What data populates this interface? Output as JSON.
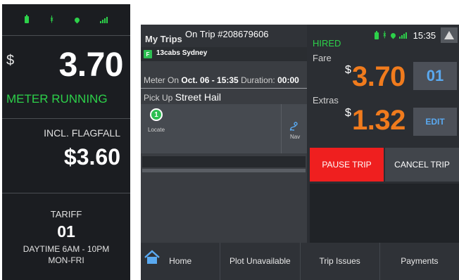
{
  "phone": {
    "status_icons": [
      "battery-icon",
      "bluetooth-icon",
      "location-icon",
      "signal-icon"
    ],
    "currency": "$",
    "fare": "3.70",
    "meter_state": "METER RUNNING",
    "flagfall_label": "INCL. FLAGFALL",
    "flagfall_amount": "$3.60",
    "tariff_label": "TARIFF",
    "tariff_number": "01",
    "tariff_desc_1": "DAYTIME 6AM - 10PM",
    "tariff_desc_2": "MON-FRI"
  },
  "tablet": {
    "header": {
      "title": "My Trips",
      "trip": "On Trip #208679606"
    },
    "company": {
      "badge": "F",
      "name": "13cabs Sydney"
    },
    "meter": {
      "label": "Meter On",
      "date": "Oct. 06 - 15:35",
      "duration_label": "Duration:",
      "duration": "00:00"
    },
    "pickup": {
      "label": "Pick Up",
      "value": "Street Hail"
    },
    "tiles": {
      "locate_number": "1",
      "locate_label": "Locate",
      "nav_label": "Nav"
    },
    "status": {
      "state": "HIRED",
      "time": "15:35"
    },
    "fare": {
      "label": "Fare",
      "currency": "$",
      "amount": "3.70",
      "tariff_button": "01"
    },
    "extras": {
      "label": "Extras",
      "currency": "$",
      "amount": "1.32",
      "edit_button": "EDIT"
    },
    "actions": {
      "pause": "PAUSE TRIP",
      "cancel": "CANCEL TRIP"
    },
    "bottom_nav": [
      "Home",
      "Plot Unavailable",
      "Trip Issues",
      "Payments"
    ]
  },
  "colors": {
    "accent_green": "#2dd14a",
    "fare_orange": "#f07b1d",
    "pause_red": "#ef1f1f",
    "tariff_blue": "#5aa9f0"
  }
}
